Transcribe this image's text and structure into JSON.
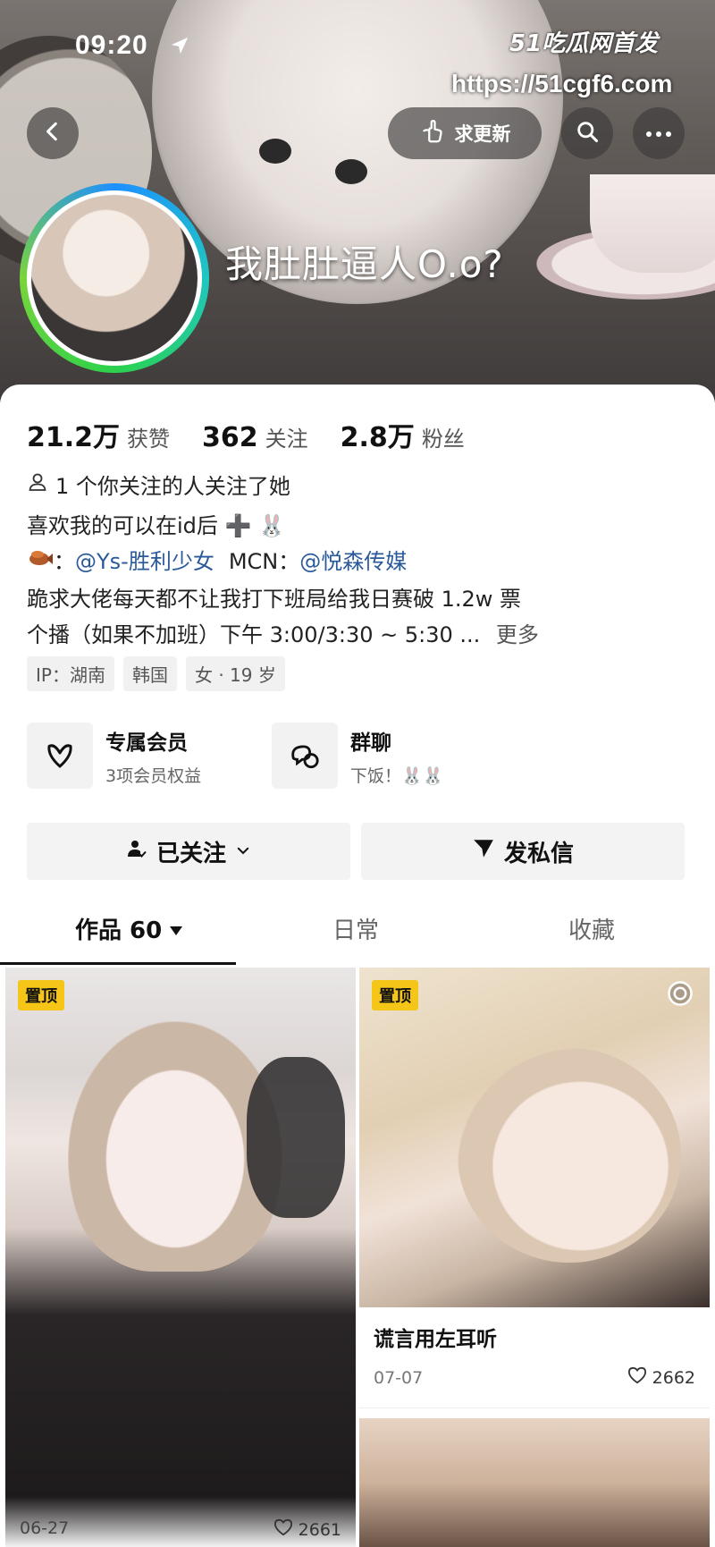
{
  "status_bar": {
    "time": "09:20"
  },
  "watermark": {
    "brand": "51吃瓜网首发",
    "url": "https://51cgf6.com"
  },
  "header": {
    "back_icon": "chevron-left-icon",
    "request_update_label": "求更新",
    "request_update_icon": "pointing-hand-icon",
    "search_icon": "search-icon",
    "more_icon": "more-dots-icon",
    "nickname": "我肚肚逼人O.o?"
  },
  "profile": {
    "stats": [
      {
        "value": "21.2万",
        "label": "获赞"
      },
      {
        "value": "362",
        "label": "关注"
      },
      {
        "value": "2.8万",
        "label": "粉丝"
      }
    ],
    "mutual": "1 个你关注的人关注了她",
    "bio_line1": "喜欢我的可以在id后 ➕ 🐰",
    "bio_line2_prefix": "：",
    "bio_line2_link1": "@Ys-胜利少女",
    "bio_line2_mcn_label": "MCN：",
    "bio_line2_link2": "@悦森传媒",
    "bio_line3": "跪求大佬每天都不让我打下班局给我日赛破 1.2w 票",
    "bio_line4": "个播（如果不加班）下午 3:00/3:30 ~ 5:30 ...",
    "more_label": "更多",
    "tags": [
      "IP：湖南",
      "韩国",
      "女 · 19 岁"
    ]
  },
  "features": [
    {
      "title": "专属会员",
      "subtitle": "3项会员权益",
      "icon": "heart-v-icon"
    },
    {
      "title": "群聊",
      "subtitle": "下饭！🐰🐰",
      "icon": "chat-bubbles-icon"
    }
  ],
  "actions": {
    "follow_label": "已关注",
    "message_label": "发私信"
  },
  "tabs": [
    {
      "label": "作品 60",
      "active": true
    },
    {
      "label": "日常",
      "active": false
    },
    {
      "label": "收藏",
      "active": false
    }
  ],
  "posts": [
    {
      "pin": "置顶",
      "date": "06-27",
      "likes": "2661"
    },
    {
      "pin": "置顶",
      "title": "谎言用左耳听",
      "date": "07-07",
      "likes": "2662"
    }
  ],
  "colors": {
    "accent_link": "#2a5a9a",
    "pin_bg": "#f5c518"
  }
}
